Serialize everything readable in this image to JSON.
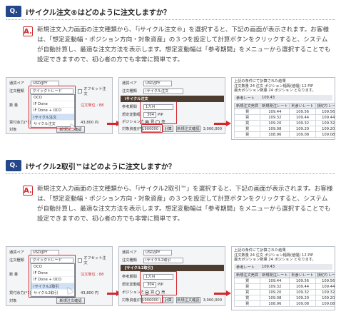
{
  "faq": [
    {
      "q_badge": "Q.",
      "question": "iサイクル注文®はどのように注文しますか？",
      "a_badge": "A.",
      "answer": "新規注文入力画面の注文種類から、「iサイクル注文®」を選択すると、下記の画面が表示されます。お客様は、「想定変動幅・ポジション方向・対象資産」の３つを設定して計算ボタンをクリックすると、システムが自動計算し、最適な注文方法を表示します。想定変動幅は「参考期間」をメニューから選択することでも設定できますので、初心者の方でも非常に簡単です。",
      "left_panel": {
        "pair_label": "通貨ペア",
        "pair_value": "USD/JPY",
        "type_label": "注文種類",
        "type_value": "クイックトレード",
        "offset_label": "オフセット注文",
        "options": [
          "OCO",
          "IF Done",
          "IF Done + OCO",
          "iサイクル注文",
          "サイクル注文"
        ],
        "highlighted_index": 3,
        "qty_label": "数 量",
        "unit_label": "注文単位 : 88",
        "purchase_label": "買付余力(*1)",
        "purchase_value": "43,800 円",
        "confirm_button": "新規注文確認",
        "note_label": "対象"
      },
      "mid_panel": {
        "pair_label": "通貨ペア",
        "pair_value": "USD/JPY",
        "type_label": "注文種類",
        "type_value": "iサイクル注文",
        "header": "iサイクル注文",
        "period_label": "参考期間",
        "period_value": "1カ月",
        "range_label": "想定変動幅",
        "range_value": "304",
        "range_unit": "PIP",
        "direction_label": "ポジション方向",
        "direction_buy": "買",
        "direction_sell": "売",
        "asset_label": "対象資産(円)",
        "asset_value": "1900000",
        "calc_button": "計算",
        "confirm_button": "新規注文確認",
        "asset_total": "3,000,000"
      },
      "result": {
        "summary_lines": [
          "上記の条件にて計算された結果",
          "注文数量 24 注文 ポジション幅隔(値幅) 12 PIP",
          "最大ポジション数量 24 ポジション となります。"
        ],
        "rate_label": "参考レート",
        "rate_value": "109.43",
        "columns": [
          "新規注文売買",
          "新規発注レート",
          "利食いレート",
          "損切りレート"
        ],
        "rows": [
          [
            "買",
            "109.44",
            "109.56",
            "109.56"
          ],
          [
            "買",
            "109.32",
            "109.44",
            "109.44"
          ],
          [
            "買",
            "109.20",
            "109.32",
            "109.32"
          ],
          [
            "買",
            "109.08",
            "109.20",
            "109.20"
          ],
          [
            "買",
            "108.96",
            "109.08",
            "109.08"
          ]
        ]
      }
    },
    {
      "q_badge": "Q.",
      "question": "iサイクル2取引™はどのように注文しますか？",
      "a_badge": "A.",
      "answer": "新規注文入力画面の注文種類から、「iサイクル2取引™」を選択すると、下記の画面が表示されます。お客様は、「想定変動幅・ポジション方向・対象資産」の３つを設定して計算ボタンをクリックすると、システムが自動計算し、最適な注文方法を表示します。想定変動幅は「参考期間」をメニューから選択することでも設定できますので、初心者の方でも非常に簡単です。",
      "left_panel": {
        "pair_label": "通貨ペア",
        "pair_value": "USD/JPY",
        "type_label": "注文種類",
        "type_value": "クイックトレード",
        "offset_label": "オフセット注文",
        "options": [
          "OCO",
          "IF Done",
          "IF Done + OCO",
          "iサイクル2取引",
          "サイクル2取引"
        ],
        "highlighted_index": 3,
        "qty_label": "数 量",
        "unit_label": "注文単位 : 88",
        "purchase_label": "買付余力(*1)",
        "purchase_value": "43,800 円",
        "confirm_button": "新規注文確認",
        "note_label": "対象"
      },
      "mid_panel": {
        "pair_label": "通貨ペア",
        "pair_value": "USD/JPY",
        "type_label": "注文種類",
        "type_value": "iサイクル2取引",
        "header": "[サイクル2取引]",
        "period_label": "参考期間",
        "period_value": "1カ月",
        "range_label": "想定変動幅",
        "range_value": "304",
        "range_unit": "PIP",
        "direction_label": "ポジション方向",
        "direction_buy": "買",
        "direction_sell": "売",
        "asset_label": "対象資産(円)",
        "asset_value": "1900000",
        "calc_button": "計算",
        "confirm_button": "新規注文確認",
        "asset_total": "3,000,000"
      },
      "result": {
        "summary_lines": [
          "上記の条件にて計算された結果",
          "注文数量 24 注文 ポジション幅隔(値幅) 12 PIP",
          "最大ポジション数量 24 ポジション となります。"
        ],
        "rate_label": "参考レート",
        "rate_value": "109.43",
        "columns": [
          "新規注文売買",
          "新規発注レート",
          "利食いレート",
          "損切りレート"
        ],
        "rows": [
          [
            "買",
            "109.44",
            "109.56",
            "109.56"
          ],
          [
            "買",
            "109.32",
            "109.44",
            "109.44"
          ],
          [
            "買",
            "109.20",
            "109.32",
            "109.32"
          ],
          [
            "買",
            "109.08",
            "109.20",
            "109.20"
          ],
          [
            "買",
            "108.96",
            "109.08",
            "109.08"
          ]
        ]
      }
    }
  ]
}
